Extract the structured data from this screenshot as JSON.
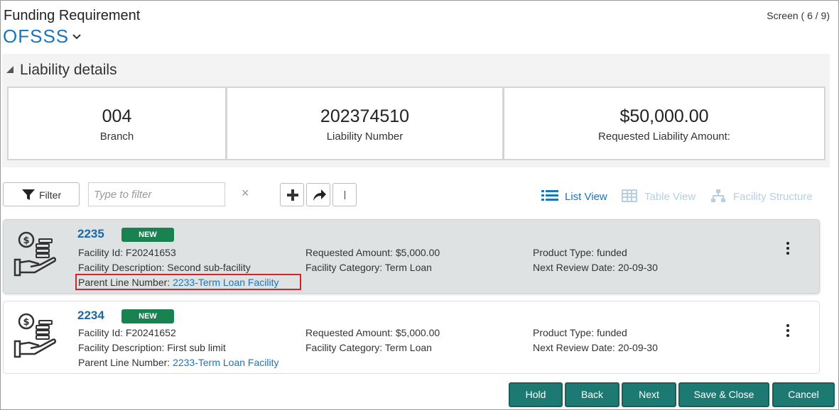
{
  "header": {
    "title": "Funding Requirement",
    "subtitle": "OFSSS",
    "screen_indicator": "Screen ( 6 / 9)"
  },
  "liability": {
    "section_title": "Liability details",
    "stats": [
      {
        "value": "004",
        "label": "Branch"
      },
      {
        "value": "202374510",
        "label": "Liability Number"
      },
      {
        "value": "$50,000.00",
        "label": "Requested Liability Amount:"
      }
    ]
  },
  "toolbar": {
    "filter_label": "Filter",
    "filter_placeholder": "Type to filter",
    "clear_symbol": "×",
    "tool_icons": [
      "plus-icon",
      "share-arrow-icon",
      "divider-icon"
    ]
  },
  "views": {
    "list": "List View",
    "table": "Table View",
    "structure": "Facility Structure",
    "active_color": "#1b75bb",
    "inactive_color": "#b8cfe3"
  },
  "facilities": [
    {
      "number": "2235",
      "badge": "NEW",
      "facility_id": "Facility Id: F20241653",
      "description": "Facility Description: Second sub-facility",
      "parent_label": "Parent Line Number: ",
      "parent_value": "2233-Term Loan Facility",
      "requested_amount": "Requested Amount: $5,000.00",
      "category": "Facility Category: Term Loan",
      "product_type": "Product Type: funded",
      "review_date": "Next Review Date: 20-09-30"
    },
    {
      "number": "2234",
      "badge": "NEW",
      "facility_id": "Facility Id: F20241652",
      "description": "Facility Description: First sub limit",
      "parent_label": "Parent Line Number: ",
      "parent_value": "2233-Term Loan Facility",
      "requested_amount": "Requested Amount: $5,000.00",
      "category": "Facility Category: Term Loan",
      "product_type": "Product Type: funded",
      "review_date": "Next Review Date: 20-09-30"
    }
  ],
  "footer": {
    "hold": "Hold",
    "back": "Back",
    "next": "Next",
    "save_close": "Save & Close",
    "cancel": "Cancel"
  },
  "colors": {
    "accent": "#1b75bb",
    "badge": "#188251",
    "footer_button": "#1d7a73",
    "highlight": "#d4232a"
  }
}
